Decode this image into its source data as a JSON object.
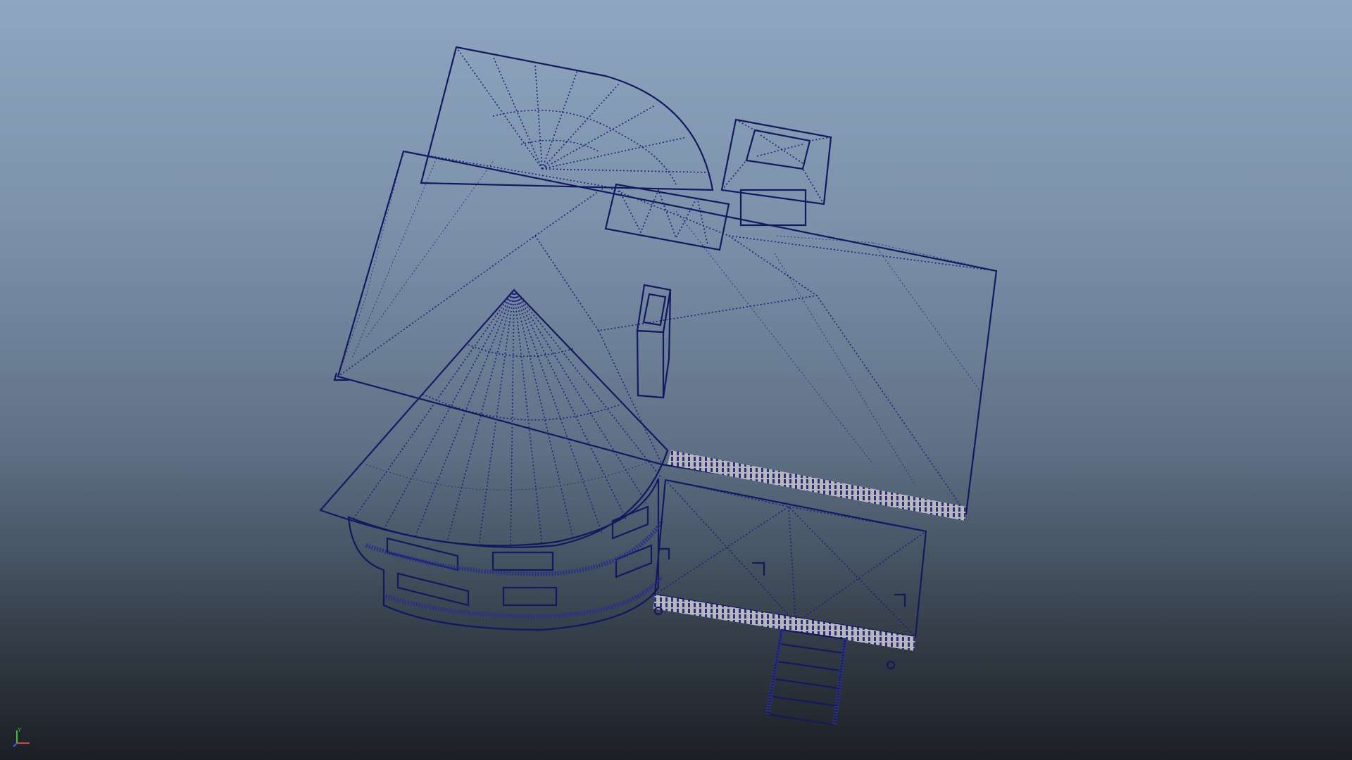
{
  "viewport": {
    "background_top": "#8fa6c0",
    "background_bottom": "#1b1f24",
    "mesh_color": "#9a9a9a",
    "wireframe_color": "#1c1f7a",
    "shading_mode": "wireframe-on-shaded"
  },
  "axis_gizmo": {
    "x_color": "#e04040",
    "y_color": "#3cc43c",
    "z_color": "#3a5bff",
    "y_label": "Y",
    "x_label": "X",
    "z_label": "Z"
  },
  "objects": [
    {
      "name": "main-hip-roof"
    },
    {
      "name": "rear-curved-roof"
    },
    {
      "name": "conical-turret-roof"
    },
    {
      "name": "cupola"
    },
    {
      "name": "chimney"
    },
    {
      "name": "front-porch-roof"
    },
    {
      "name": "porch-steps"
    },
    {
      "name": "turret-walls-with-windows"
    }
  ]
}
